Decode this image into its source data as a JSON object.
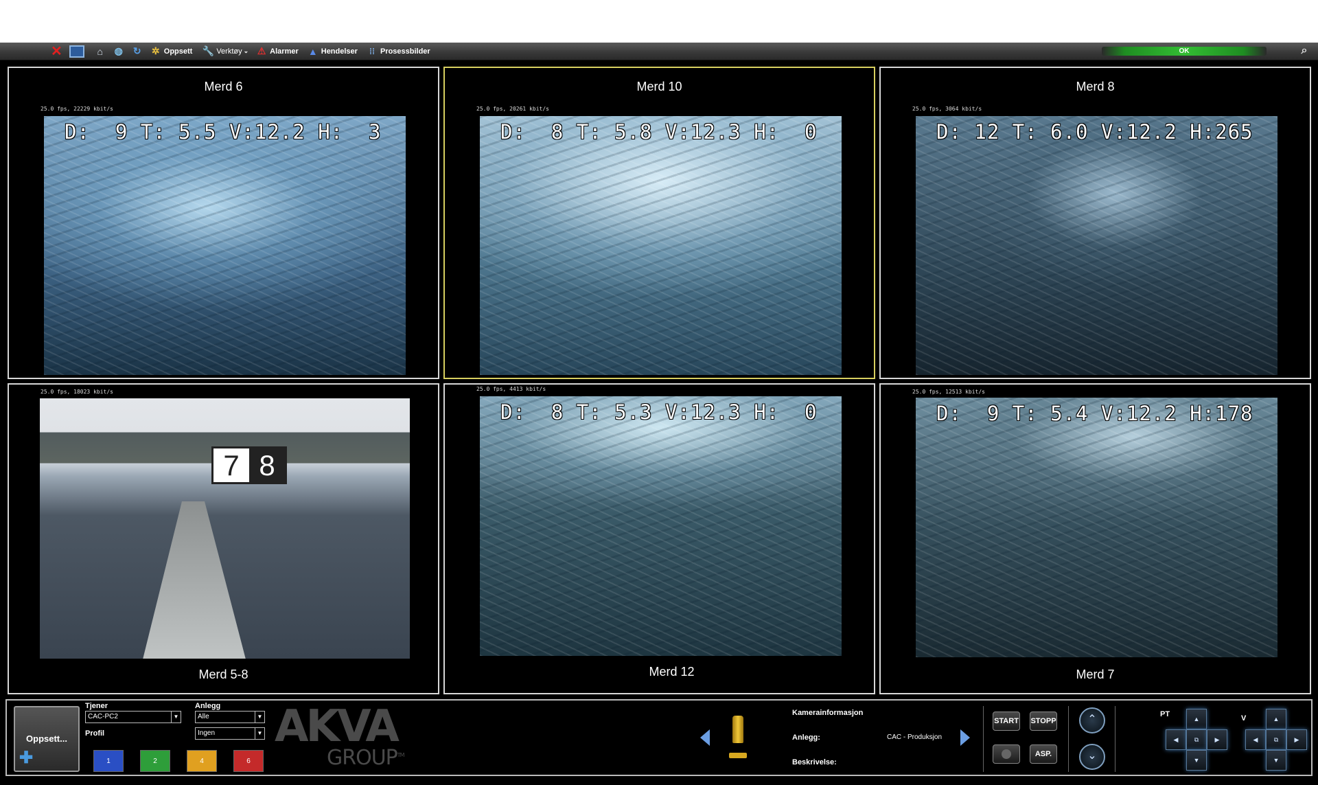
{
  "toolbar": {
    "oppsett_label": "Oppsett",
    "verktoy_label": "Verktøy",
    "alarmer_label": "Alarmer",
    "hendelser_label": "Hendelser",
    "prosessbilder_label": "Prosessbilder",
    "status_text": "OK",
    "icons": [
      "close-icon",
      "monitor-icon",
      "home-icon",
      "globe-icon",
      "refresh-icon",
      "settings-icon",
      "wrench-icon",
      "alarm-warning-icon",
      "event-icon",
      "grid-icon",
      "search-icon"
    ]
  },
  "cameras": [
    {
      "title": "Merd 6",
      "stats": "25.0 fps, 22229 kbit/s",
      "osd": "D:  9 T: 5.5 V:12.2 H:  3"
    },
    {
      "title": "Merd 10",
      "stats": "25.0 fps, 20261 kbit/s",
      "osd": "D:  8 T: 5.8 V:12.3 H:  0",
      "selected": true
    },
    {
      "title": "Merd 8",
      "stats": "25.0 fps, 3064 kbit/s",
      "osd": "D: 12 T: 6.0 V:12.2 H:265"
    },
    {
      "title": "Merd 5-8",
      "stats": "25.0 fps, 18023 kbit/s",
      "sign": [
        "7",
        "8"
      ]
    },
    {
      "title": "Merd 12",
      "stats": "25.0 fps, 4413 kbit/s",
      "osd": "D:  8 T: 5.3 V:12.3 H:  0"
    },
    {
      "title": "Merd 7",
      "stats": "25.0 fps, 12513 kbit/s",
      "osd": "D:  9 T: 5.4 V:12.2 H:178"
    }
  ],
  "bottom": {
    "oppsett_button": "Oppsett...",
    "tjener_label": "Tjener",
    "tjener_value": "CAC-PC2",
    "anlegg_label": "Anlegg",
    "anlegg_value": "Alle",
    "profil_label": "Profil",
    "profil_value": "Ingen",
    "profile_buttons": [
      {
        "label": "1",
        "color": "#2a4fc4"
      },
      {
        "label": "2",
        "color": "#2e9e3a"
      },
      {
        "label": "4",
        "color": "#e0a020"
      },
      {
        "label": "6",
        "color": "#c42a2a"
      }
    ],
    "logo_top": "AKVA",
    "logo_bottom": "GROUP",
    "logo_tm": "TM",
    "kamerainfo_label": "Kamerainformasjon",
    "info_anlegg_label": "Anlegg:",
    "info_anlegg_value": "CAC - Produksjon",
    "info_beskrivelse_label": "Beskrivelse:",
    "start_label": "START",
    "stopp_label": "STOPP",
    "asp_label": "ASP.",
    "pt_label": "PT",
    "v_label": "V"
  }
}
